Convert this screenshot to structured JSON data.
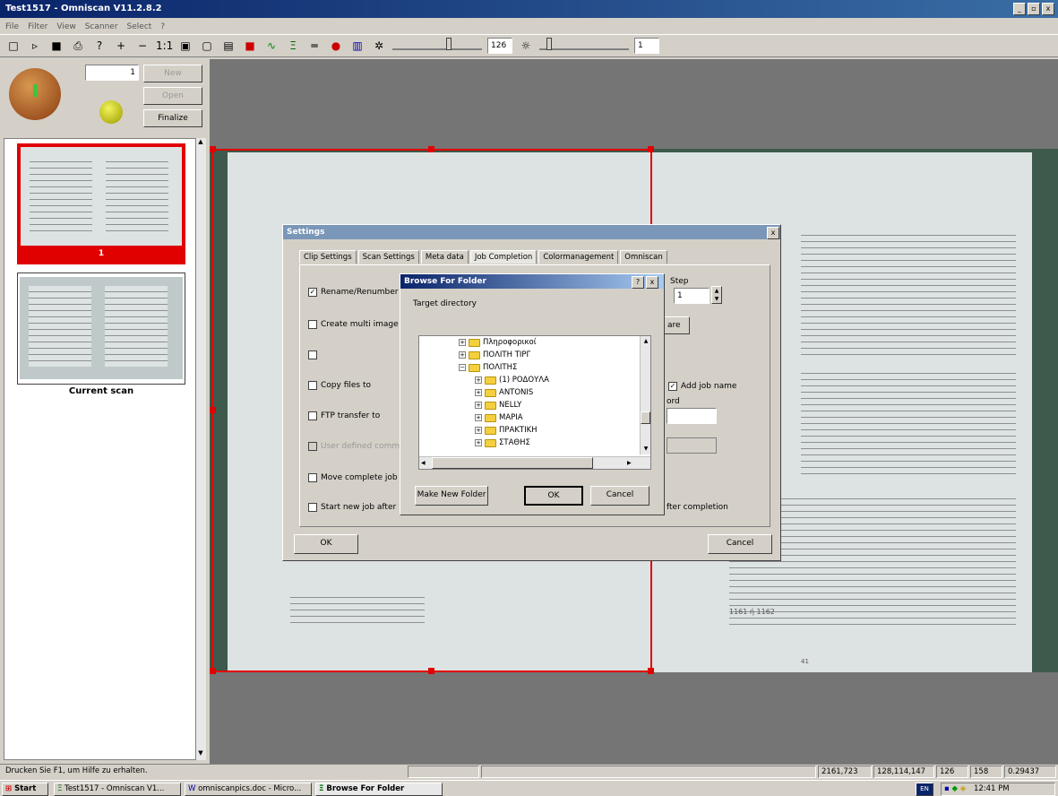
{
  "window": {
    "title": "Test1517 - Omniscan V11.2.8.2",
    "buttons": [
      "_",
      "▫",
      "x"
    ]
  },
  "menu": [
    "File",
    "Filter",
    "View",
    "Scanner",
    "Select",
    "?"
  ],
  "toolbar": {
    "brightness_value": "126",
    "contrast_value": "1"
  },
  "left_panel": {
    "counter": "1",
    "buttons": {
      "new": "New",
      "open": "Open",
      "finalize": "Finalize"
    },
    "thumb_num": "1",
    "current_scan_label": "Current scan"
  },
  "settings_dialog": {
    "title": "Settings",
    "tabs": [
      "Clip Settings",
      "Scan Settings",
      "Meta data",
      "Job Completion",
      "Colormanagement",
      "Omniscan"
    ],
    "options": [
      "Rename/Renumber",
      "Create multi image f",
      "",
      "Copy files to",
      "FTP transfer to",
      "User defined comm",
      "Move complete job t",
      "Start new job after"
    ],
    "step_label": "Step",
    "step_value": "1",
    "browse_partial": "are",
    "add_job_name": "Add job name",
    "word_label": "ord",
    "after_completion": "fter completion",
    "ok": "OK",
    "cancel": "Cancel"
  },
  "browse_dialog": {
    "title": "Browse For Folder",
    "target_label": "Target directory",
    "folders": [
      "Πληροφορικοί",
      "ΠΟΛΙΤΗ ΤΙΡΓ",
      "ΠΟΛΙΤΗΣ",
      "(1) ΡΟΔΟΥΛΑ",
      "ANTONIS",
      "NELLY",
      "ΜΑΡΙΑ",
      "ΠΡΑΚΤΙΚΗ",
      "ΣΤΑΘΗΣ"
    ],
    "make_new_folder": "Make New Folder",
    "ok": "OK",
    "cancel": "Cancel"
  },
  "status_bar": {
    "help": "Drucken Sie F1, um Hilfe zu erhalten.",
    "coords": "2161,723",
    "rgb": "128,114,147",
    "v1": "126",
    "v2": "158",
    "v3": "0.29437"
  },
  "taskbar": {
    "start": "Start",
    "tasks": [
      "Test1517 - Omniscan V1...",
      "omniscanpics.doc - Micro...",
      "Browse For Folder"
    ],
    "clock": "12:41 PM"
  },
  "book": {
    "page_num_right": "41",
    "caption_left": "1161 ή 1162"
  },
  "colors": {
    "title_blue": "#0a246a",
    "selection_red": "#e00000",
    "orb_green": "#3cc63c",
    "orb_yellow": "#d6d600"
  }
}
